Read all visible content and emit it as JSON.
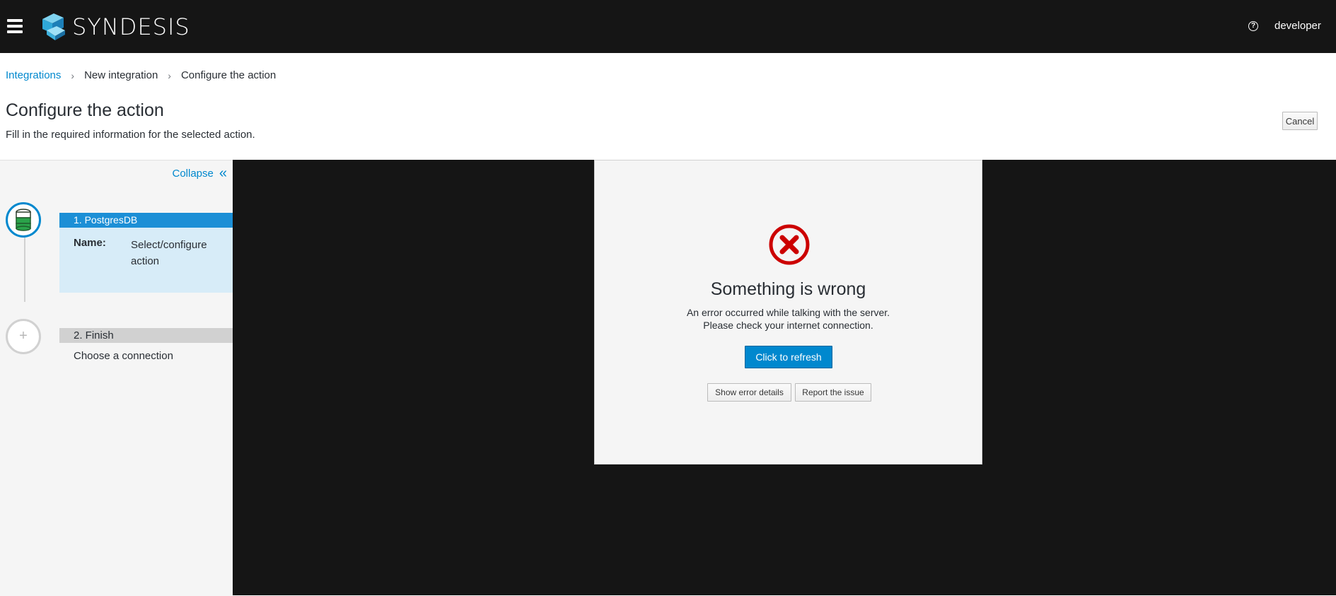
{
  "masthead": {
    "brand": "SYNDESIS",
    "user": "developer",
    "help_icon": "question-circle-icon",
    "menu_icon": "hamburger-icon"
  },
  "breadcrumb": {
    "items": [
      "Integrations",
      "New integration",
      "Configure the action"
    ]
  },
  "page": {
    "title": "Configure the action",
    "description": "Fill in the required information for the selected action.",
    "cancel_label": "Cancel"
  },
  "sidebar": {
    "collapse_label": "Collapse",
    "steps": [
      {
        "title": "1. PostgresDB",
        "name_label": "Name:",
        "name_value": "Select/configure action",
        "icon": "database-icon"
      },
      {
        "title": "2. Finish",
        "description": "Choose a connection",
        "icon": "plus-icon"
      }
    ]
  },
  "error": {
    "title": "Something is wrong",
    "message_line1": "An error occurred while talking with the server.",
    "message_line2": "Please check your internet connection.",
    "refresh_label": "Click to refresh",
    "details_label": "Show error details",
    "report_label": "Report the issue",
    "icon": "error-circle-icon"
  },
  "colors": {
    "masthead": "#151515",
    "accent": "#0088ce",
    "error": "#cc0000",
    "active_step": "#1c8fd6",
    "active_step_body": "#d7ecf8"
  }
}
